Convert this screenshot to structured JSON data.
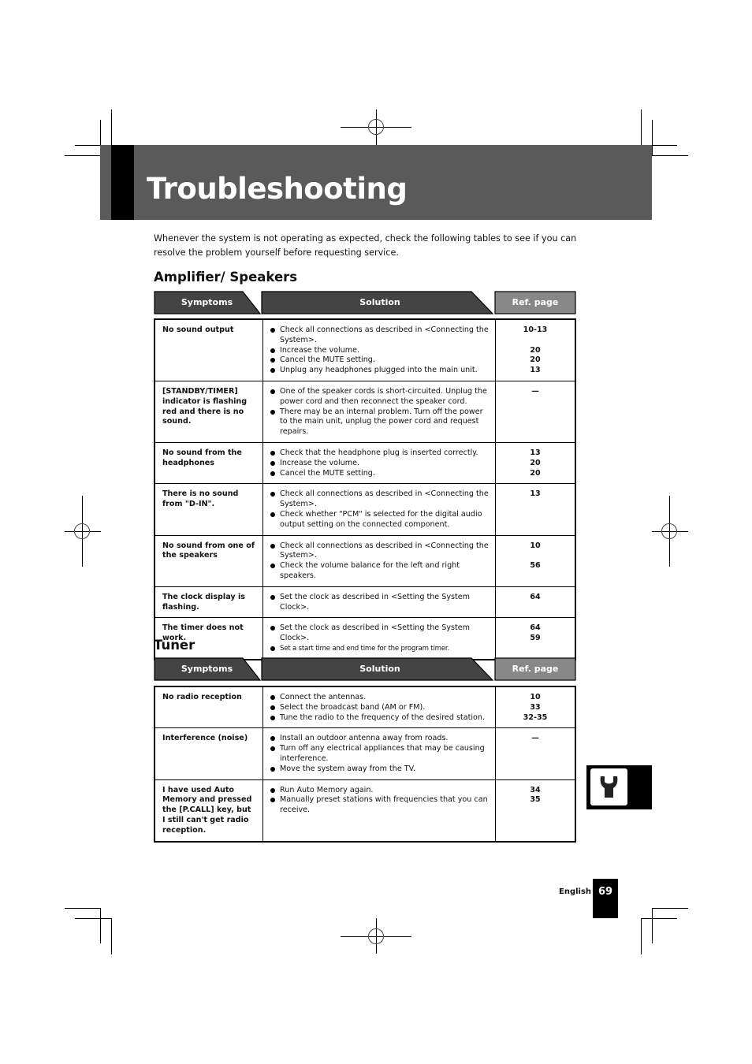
{
  "page": {
    "title": "Troubleshooting",
    "intro": "Whenever the system is not operating as expected, check the following tables to see if you can resolve the problem yourself before requesting service.",
    "language": "English",
    "page_number": "69",
    "side_tab_icon": "wrench-icon"
  },
  "columns": {
    "symptoms": "Symptoms",
    "solution": "Solution",
    "ref_page": "Ref. page"
  },
  "colors": {
    "banner": "#5a5a5a",
    "header_dark": "#444444",
    "header_ref": "#888888"
  },
  "sections": [
    {
      "title": "Amplifier/ Speakers",
      "rows": [
        {
          "symptom": "No sound output",
          "solutions": [
            "Check all connections  as described in <Connecting the System>.",
            "Increase the volume.",
            "Cancel the MUTE setting.",
            "Unplug any headphones plugged into the main unit."
          ],
          "refs": [
            "10-13",
            "",
            "20",
            "20",
            "13"
          ]
        },
        {
          "symptom": "[STANDBY/TIMER] indicator is flashing red and there is no sound.",
          "solutions": [
            "One of the speaker cords is short-circuited. Unplug the power cord and then reconnect the speaker cord.",
            "There may be an internal problem. Turn off the power to the main unit, unplug the power cord and request repairs."
          ],
          "refs": [
            "—"
          ]
        },
        {
          "symptom": "No sound from the headphones",
          "solutions": [
            "Check that the headphone plug is inserted correctly.",
            "Increase the volume.",
            "Cancel the MUTE setting."
          ],
          "refs": [
            "13",
            "20",
            "20"
          ]
        },
        {
          "symptom": "There is no sound from \"D-IN\".",
          "solutions": [
            "Check all connections  as described in <Connecting the System>.",
            "Check whether \"PCM\" is selected for the digital audio output setting on the connected component."
          ],
          "refs": [
            "13"
          ]
        },
        {
          "symptom": "No sound from one of the speakers",
          "solutions": [
            "Check all connections  as described in <Connecting the System>.",
            "Check the volume balance for the left and right speakers."
          ],
          "refs": [
            "10",
            "",
            "56"
          ]
        },
        {
          "symptom": "The clock display is flashing.",
          "solutions": [
            "Set the clock as described in <Setting the System Clock>."
          ],
          "refs": [
            "64"
          ]
        },
        {
          "symptom": "The timer does not work.",
          "solutions": [
            "Set the clock as described in <Setting the System Clock>.",
            "Set a start time and end time for the program timer."
          ],
          "refs": [
            "64",
            "59"
          ]
        }
      ]
    },
    {
      "title": "Tuner",
      "rows": [
        {
          "symptom": "No radio reception",
          "solutions": [
            "Connect the antennas.",
            "Select the broadcast band (AM or FM).",
            "Tune the radio to the frequency of the desired station."
          ],
          "refs": [
            "10",
            "33",
            "32-35"
          ]
        },
        {
          "symptom": "Interference (noise)",
          "solutions": [
            "Install an outdoor antenna away from roads.",
            "Turn off any electrical appliances that may be causing interference.",
            "Move the system away from the TV."
          ],
          "refs": [
            "—"
          ]
        },
        {
          "symptom": "I have used Auto Memory and pressed the [P.CALL] key, but I still can't get radio reception.",
          "solutions": [
            "Run Auto Memory again.",
            "Manually preset stations with frequencies that you can receive."
          ],
          "refs": [
            "34",
            "35"
          ]
        }
      ]
    }
  ]
}
